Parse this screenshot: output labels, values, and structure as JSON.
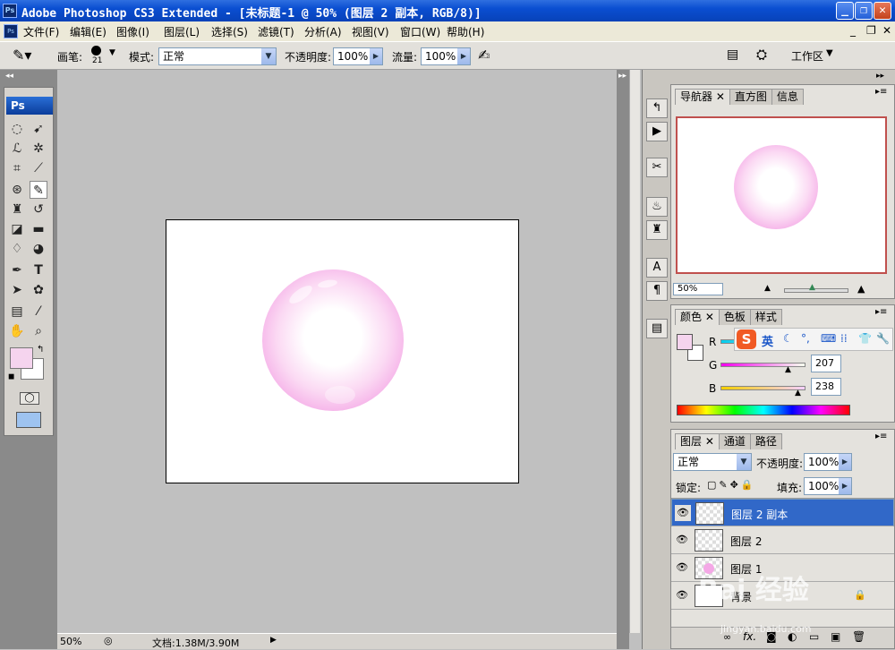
{
  "window": {
    "title": "Adobe Photoshop CS3 Extended - [未标题-1 @ 50% (图层 2 副本, RGB/8)]",
    "app_icon": "Ps"
  },
  "menu": [
    "文件(F)",
    "编辑(E)",
    "图像(I)",
    "图层(L)",
    "选择(S)",
    "滤镜(T)",
    "分析(A)",
    "视图(V)",
    "窗口(W)",
    "帮助(H)"
  ],
  "options": {
    "brush_label": "画笔:",
    "brush_size": "21",
    "mode_label": "模式:",
    "mode_value": "正常",
    "opacity_label": "不透明度:",
    "opacity_value": "100%",
    "flow_label": "流量:",
    "flow_value": "100%",
    "workspace": "工作区"
  },
  "toolbox": {
    "logo": "Ps"
  },
  "statusbar": {
    "zoom": "50%",
    "doc_info": "文档:1.38M/3.90M"
  },
  "navigator": {
    "tabs": [
      "导航器",
      "直方图",
      "信息"
    ],
    "zoom": "50%"
  },
  "color_panel": {
    "tabs": [
      "颜色",
      "色板",
      "样式"
    ],
    "channels": [
      {
        "label": "R",
        "value": ""
      },
      {
        "label": "G",
        "value": "207"
      },
      {
        "label": "B",
        "value": "238"
      }
    ],
    "ime_bar": {
      "logo": "S",
      "mode": "英"
    }
  },
  "layers_panel": {
    "tabs": [
      "图层",
      "通道",
      "路径"
    ],
    "blend_mode": "正常",
    "opacity_label": "不透明度:",
    "opacity_value": "100%",
    "lock_label": "锁定:",
    "fill_label": "填充:",
    "fill_value": "100%",
    "layers": [
      {
        "name": "图层 2 副本",
        "selected": true
      },
      {
        "name": "图层 2",
        "selected": false
      },
      {
        "name": "图层 1",
        "selected": false
      },
      {
        "name": "背景",
        "selected": false
      }
    ]
  },
  "watermark": {
    "text": "Bai 经验",
    "url": "jingyan.baidu.com"
  },
  "colors": {
    "bubble_pink": "#ee8fde",
    "foreground": "#f5d4ee",
    "selection": "#3168c8"
  }
}
